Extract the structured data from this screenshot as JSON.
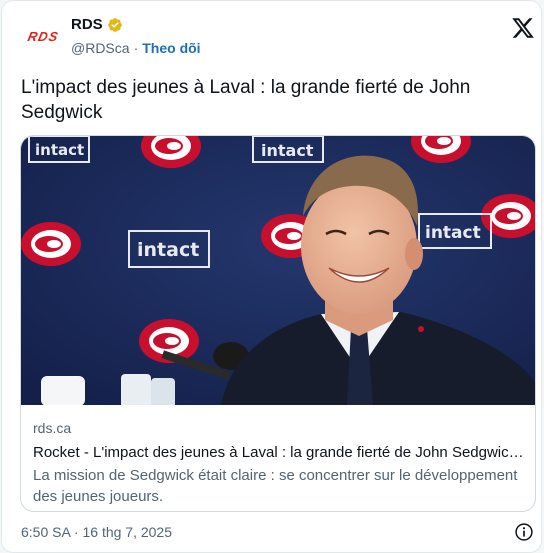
{
  "account": {
    "logo_text": "RDS",
    "display_name": "RDS",
    "handle": "@RDSca",
    "separator": "·",
    "follow_label": "Theo dõi"
  },
  "tweet": {
    "text": "L'impact des jeunes à Laval : la grande fierté de John Sedgwick"
  },
  "link_card": {
    "domain": "rds.ca",
    "title": "Rocket - L'impact des jeunes à Laval : la grande fierté de John Sedgwick ...",
    "description": "La mission de Sedgwick était claire : se concentrer sur le développement des jeunes joueurs.",
    "photo_backdrop_text": "intact"
  },
  "footer": {
    "timestamp": "6:50 SA · 16 thg 7, 2025"
  },
  "colors": {
    "brand_red": "#e2231a",
    "verified_gold": "#e2b719",
    "link_blue": "#1d6fb8",
    "secondary_text": "#536471",
    "backdrop_navy": "#1b2a5a"
  }
}
